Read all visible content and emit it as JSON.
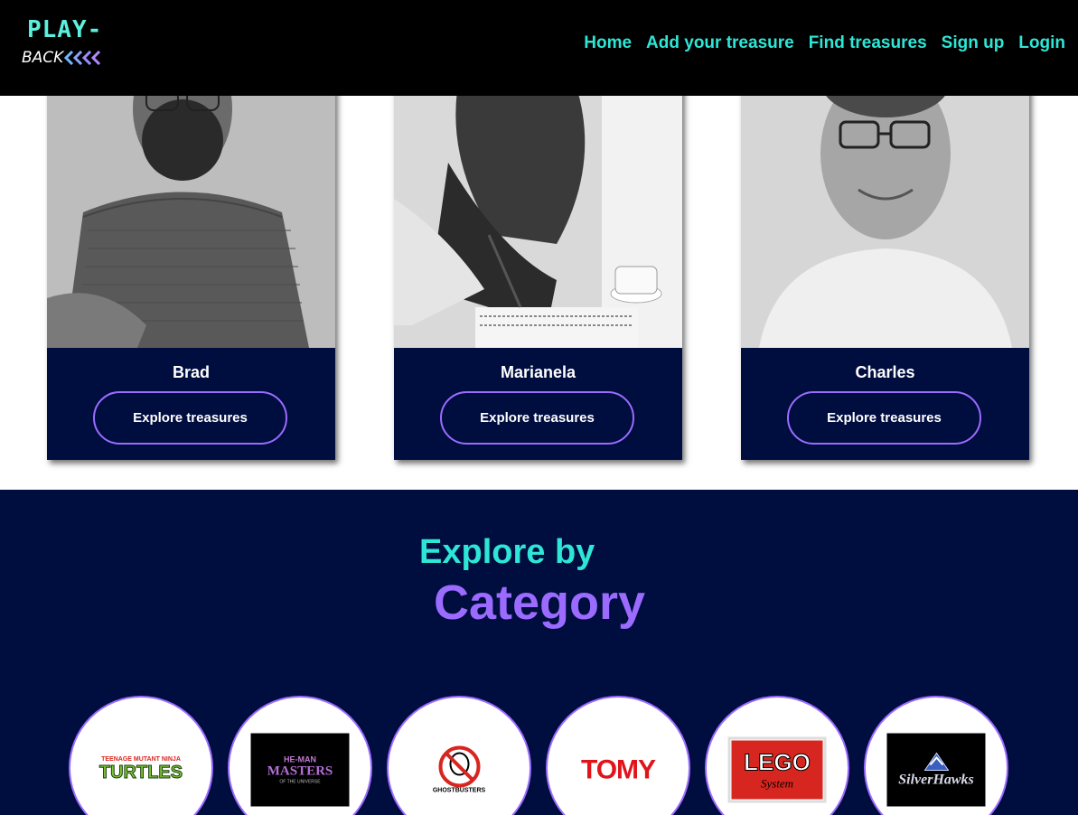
{
  "header": {
    "logo": {
      "line1": "PLAY-",
      "line2": "BACK"
    },
    "nav": [
      {
        "label": "Home"
      },
      {
        "label": "Add your treasure"
      },
      {
        "label": "Find treasures"
      },
      {
        "label": "Sign up"
      },
      {
        "label": "Login"
      }
    ]
  },
  "collectors": [
    {
      "name": "Brad",
      "button": "Explore treasures"
    },
    {
      "name": "Marianela",
      "button": "Explore treasures"
    },
    {
      "name": "Charles",
      "button": "Explore treasures"
    }
  ],
  "categories_section": {
    "title_line1": "Explore by",
    "title_line2": "Category",
    "items": [
      {
        "logo_top": "TEENAGE MUTANT NINJA",
        "logo_main": "TURTLES"
      },
      {
        "logo_top": "HE-MAN",
        "logo_main": "MASTERS",
        "logo_bottom": "OF THE UNIVERSE"
      },
      {
        "logo_main": "GHOSTBUSTERS"
      },
      {
        "logo_main": "TOMY"
      },
      {
        "logo_main": "LEGO",
        "logo_bottom": "System"
      },
      {
        "logo_main": "SilverHawks"
      }
    ]
  },
  "colors": {
    "navy": "#000d3f",
    "teal": "#2ee6d6",
    "purple": "#9b6bff",
    "header": "#000000"
  }
}
